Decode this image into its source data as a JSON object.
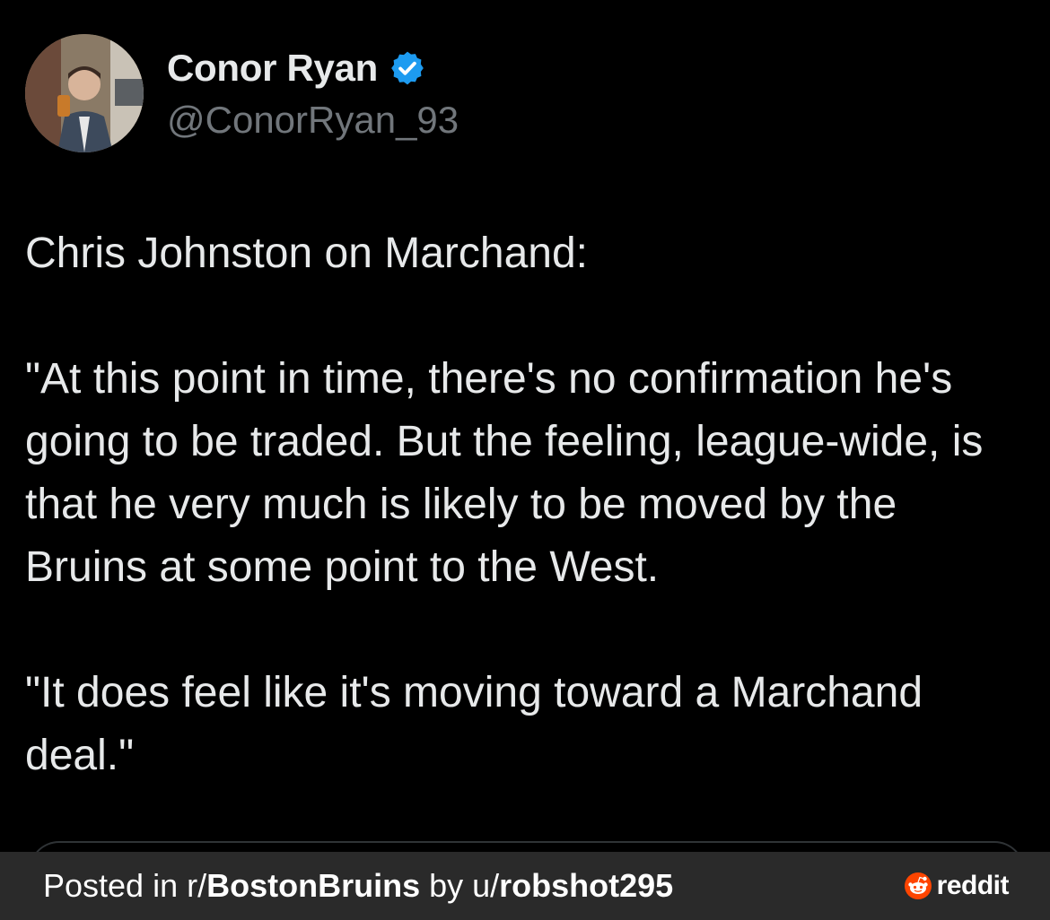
{
  "author": {
    "display_name": "Conor Ryan",
    "handle": "@ConorRyan_93",
    "verified_icon": "verified-badge-icon",
    "badge_color": "#1d9bf0"
  },
  "tweet": {
    "text": "Chris Johnston on Marchand:\n\n\"At this point in time, there's no confirmation he's going to be traded. But the feeling, league-wide, is that he very much is likely to be moved by the Bruins at some point to the West.\n\n\"It does feel like it's moving toward a Marchand deal.\""
  },
  "footer": {
    "posted_in": "Posted in r/",
    "subreddit": "BostonBruins",
    "by": " by u/",
    "username": "robshot295",
    "brand": "reddit",
    "brand_color": "#ff4500"
  }
}
